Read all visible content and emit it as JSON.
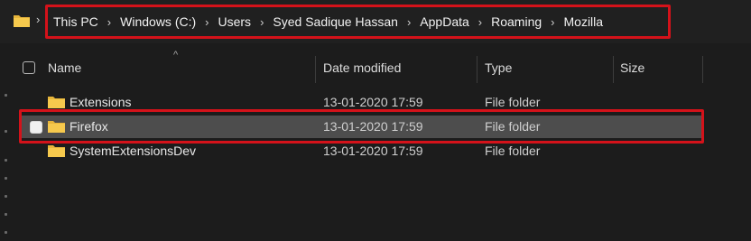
{
  "address_bar": {
    "crumbs": [
      "This PC",
      "Windows (C:)",
      "Users",
      "Syed Sadique Hassan",
      "AppData",
      "Roaming",
      "Mozilla"
    ],
    "separator": "›",
    "folder_icon": "folder-icon"
  },
  "columns": {
    "name": "Name",
    "date": "Date modified",
    "type": "Type",
    "size": "Size",
    "sort_indicator": "^"
  },
  "rows": [
    {
      "name": "Extensions",
      "date": "13-01-2020 17:59",
      "type": "File folder"
    },
    {
      "name": "Firefox",
      "date": "13-01-2020 17:59",
      "type": "File folder"
    },
    {
      "name": "SystemExtensionsDev",
      "date": "13-01-2020 17:59",
      "type": "File folder"
    }
  ],
  "colors": {
    "background": "#1c1c1c",
    "selection": "#4d4d4d",
    "highlight_box": "#d4121a",
    "folder": "#f4c542"
  }
}
